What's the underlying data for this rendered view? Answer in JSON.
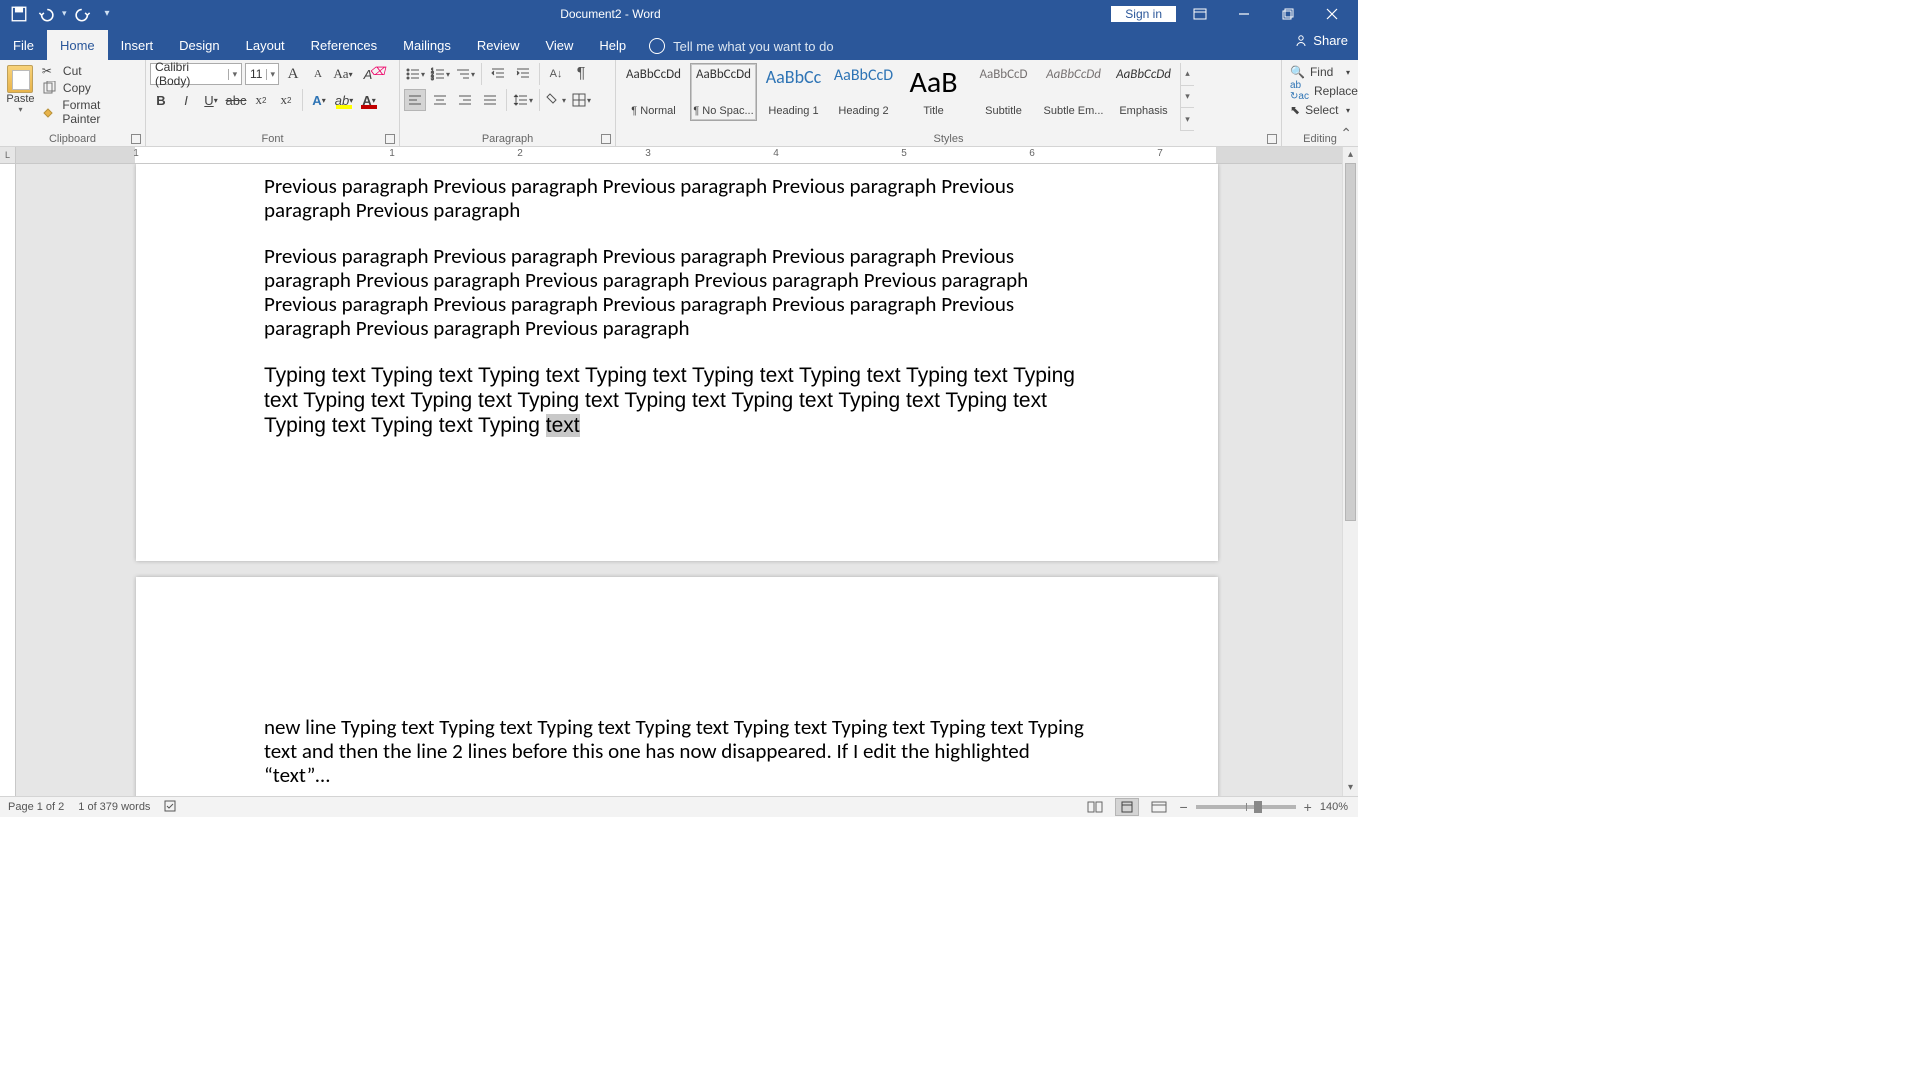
{
  "title": "Document2  -  Word",
  "qat": {
    "save": "save-icon",
    "undo": "undo-icon",
    "redo": "redo-icon"
  },
  "titlebar_buttons": {
    "signin": "Sign in"
  },
  "tabs": [
    "File",
    "Home",
    "Insert",
    "Design",
    "Layout",
    "References",
    "Mailings",
    "Review",
    "View",
    "Help"
  ],
  "tellme": "Tell me what you want to do",
  "share": "Share",
  "clipboard": {
    "paste": "Paste",
    "cut": "Cut",
    "copy": "Copy",
    "format_painter": "Format Painter",
    "label": "Clipboard"
  },
  "font": {
    "name": "Calibri (Body)",
    "size": "11",
    "label": "Font"
  },
  "paragraph": {
    "label": "Paragraph"
  },
  "styles": {
    "label": "Styles",
    "items": [
      {
        "preview": "AaBbCcDd",
        "name": "¶ Normal",
        "size": 13,
        "color": "#333"
      },
      {
        "preview": "AaBbCcDd",
        "name": "¶ No Spac...",
        "size": 13,
        "color": "#333",
        "selected": true
      },
      {
        "preview": "AaBbCc",
        "name": "Heading 1",
        "size": 18,
        "color": "#2e74b5"
      },
      {
        "preview": "AaBbCcD",
        "name": "Heading 2",
        "size": 16,
        "color": "#2e74b5"
      },
      {
        "preview": "AaB",
        "name": "Title",
        "size": 30,
        "color": "#000"
      },
      {
        "preview": "AaBbCcD",
        "name": "Subtitle",
        "size": 13,
        "color": "#767171"
      },
      {
        "preview": "AaBbCcDd",
        "name": "Subtle Em...",
        "size": 13,
        "color": "#767171",
        "italic": true
      },
      {
        "preview": "AaBbCcDd",
        "name": "Emphasis",
        "size": 13,
        "color": "#333",
        "italic": true
      }
    ]
  },
  "editing": {
    "find": "Find",
    "replace": "Replace",
    "select": "Select",
    "label": "Editing"
  },
  "document": {
    "para1": "Previous paragraph Previous paragraph Previous paragraph Previous paragraph Previous paragraph Previous paragraph",
    "para2": "Previous paragraph Previous paragraph Previous paragraph Previous paragraph Previous paragraph Previous paragraph Previous paragraph Previous paragraph Previous paragraph Previous paragraph Previous paragraph Previous paragraph Previous paragraph Previous paragraph Previous paragraph Previous paragraph",
    "para3_pre": "Typing text Typing text Typing text Typing text Typing text Typing text Typing text Typing text Typing text Typing text Typing text Typing text Typing text Typing text Typing text Typing text Typing text Typing ",
    "para3_hl": "text",
    "para4": "new line Typing text Typing text Typing text Typing text Typing text Typing text Typing text Typing text and then the line 2 lines before this one has now disappeared. If I edit the highlighted “text”…"
  },
  "ruler": {
    "nums": [
      "1",
      "2",
      "3",
      "4",
      "5",
      "6",
      "7"
    ]
  },
  "status": {
    "page": "Page 1 of 2",
    "words": "1 of 379 words",
    "zoom": "140%"
  }
}
